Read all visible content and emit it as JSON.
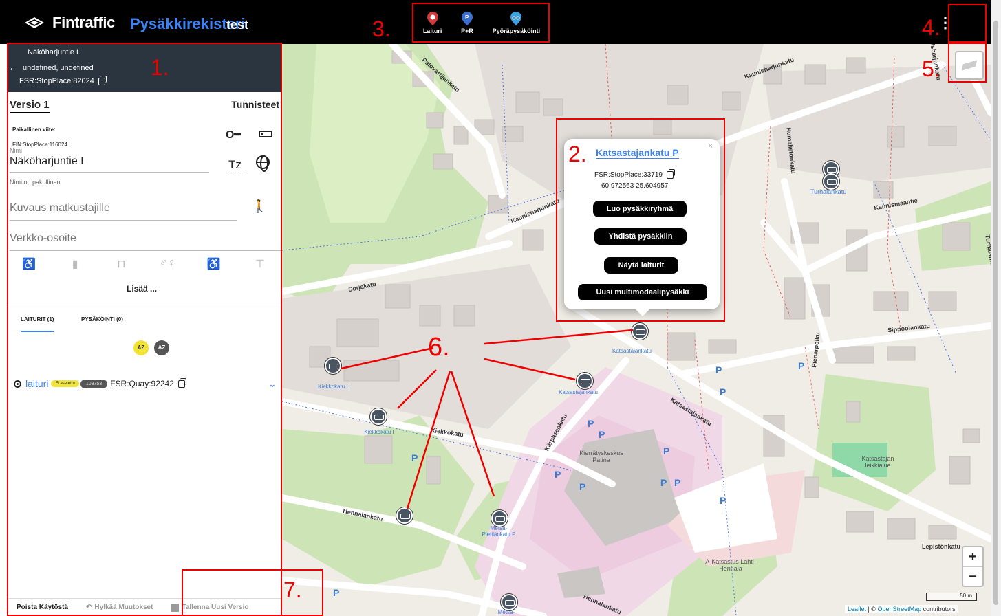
{
  "header": {
    "brand": "Fintraffic",
    "app_title": "Pysäkkirekisteri",
    "env": "test",
    "new_stop_buttons": [
      {
        "label": "Laituri",
        "color": "#d13a3a"
      },
      {
        "label": "P+R",
        "color": "#3a6fd1"
      },
      {
        "label": "Pyöräpysäköinti",
        "color": "#3aa0e0"
      }
    ],
    "more_icon": "⋮"
  },
  "sidebar": {
    "stop_name": "Näköharjuntie I",
    "back_text": "undefined, undefined",
    "stop_place_id": "FSR:StopPlace:82024",
    "version_label": "Versio 1",
    "identifiers_label": "Tunnisteet",
    "local_ref_label": "Paikallinen viite:",
    "local_ref_value": "FIN:StopPlace:116024",
    "name_label": "Nimi",
    "name_value": "Näköharjuntie I",
    "timezone_label": "Tz",
    "name_required": "Nimi on pakollinen",
    "description_placeholder": "Kuvaus matkustajille",
    "url_placeholder": "Verkko-osoite",
    "facilities": [
      "♿",
      "▮",
      "⊓",
      "♂♀",
      "♿",
      "⊤"
    ],
    "add_more": "Lisää ...",
    "tabs": [
      "LAITURIT (1)",
      "PYSÄKÖINTI (0)"
    ],
    "az_badges": [
      "AZ",
      "AZ"
    ],
    "quay": {
      "name": "laituri",
      "pill_yellow": "Ei asetettu",
      "pill_gray": "103753",
      "id": "FSR:Quay:92242"
    },
    "footer": {
      "deactivate": "Poista Käytöstä",
      "undo": "Hylkää Muutokset",
      "save": "Tallenna Uusi Versio"
    }
  },
  "popup": {
    "title": "Katsastajankatu P",
    "id": "FSR:StopPlace:33719",
    "coords": "60.972563 25.604957",
    "buttons": [
      "Luo pysäkkiryhmä",
      "Yhdistä pysäkkiin",
      "Näytä laiturit",
      "Uusi multimodaalipysäkki"
    ],
    "close": "×"
  },
  "map": {
    "roads": [
      "Palovartijankatu",
      "Kaunisharjunkatu",
      "Kaunisharjunkatu",
      "Kaunisharjunkatu",
      "Sorjakatu",
      "Kiekkokatu",
      "Hennalankatu",
      "Kärpäsenkatu",
      "Katsastajankatu",
      "Sippoolankatu",
      "Kaunismaantie",
      "Humalistonkatu",
      "Turhalankatu",
      "Turhalankatu",
      "Pienarpolku",
      "Lepistönkatu",
      "Hennalankatu"
    ],
    "places": [
      "Kierrätyskeskus Patina",
      "Katsastajan leikkialue",
      "A-Katsastus Lahti-Hennala"
    ],
    "stops": [
      {
        "label": "Katsastajankatu"
      },
      {
        "label": "Kiekkokatu L"
      },
      {
        "label": "Kiekkokatu I"
      },
      {
        "label": "Katsastajankatu"
      },
      {
        "label": "Metsä-Pietilänkatu P"
      },
      {
        "label": "Metsä-Pietilänkatu"
      },
      {
        "label": "Turhalankatu"
      }
    ],
    "zoom_in": "+",
    "zoom_out": "−",
    "scale": "50 m",
    "attribution_leaflet": "Leaflet",
    "attribution_sep": "| ©",
    "attribution_osm": "OpenStreetMap",
    "attribution_contrib": "contributors"
  },
  "annotations": [
    "1.",
    "2.",
    "3.",
    "4.",
    "5.",
    "6.",
    "7."
  ]
}
